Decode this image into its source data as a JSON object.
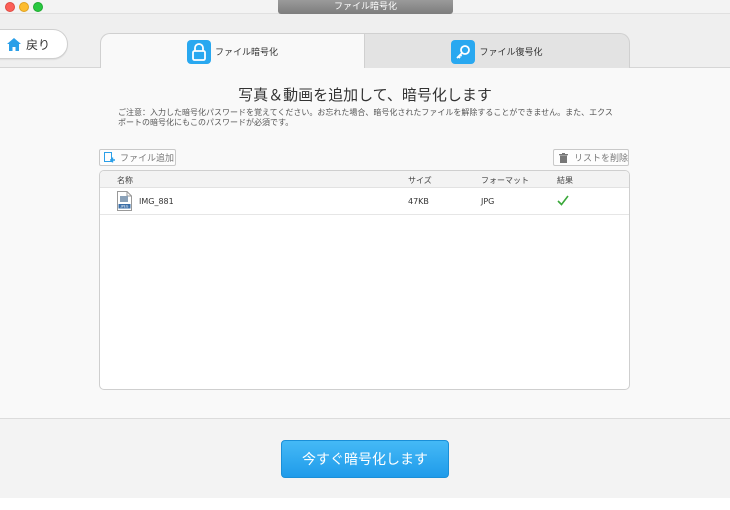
{
  "window": {
    "title": "ファイル暗号化"
  },
  "header": {
    "back_label": "戻り",
    "tabs": [
      {
        "label": "ファイル暗号化",
        "icon": "lock-icon",
        "active": true
      },
      {
        "label": "ファイル復号化",
        "icon": "key-icon",
        "active": false
      }
    ]
  },
  "main": {
    "heading": "写真＆動画を追加して、暗号化します",
    "notice": "ご注意：入力した暗号化パスワードを覚えてください。お忘れた場合、暗号化されたファイルを解除することができません。また、エクスポートの暗号化にもこのパスワードが必須です。",
    "add_label": "ファイル追加",
    "clear_label": "リストを削除"
  },
  "table": {
    "columns": [
      "名称",
      "サイズ",
      "フォーマット",
      "結果"
    ],
    "rows": [
      {
        "name": "IMG_881",
        "size": "47KB",
        "format": "JPG",
        "status": "success",
        "icon_badge": "JPEG"
      }
    ]
  },
  "footer": {
    "encrypt_label": "今すぐ暗号化します"
  },
  "colors": {
    "accent": "#29a8f0",
    "button": "#2aa6ef",
    "success": "#3aa83a"
  }
}
